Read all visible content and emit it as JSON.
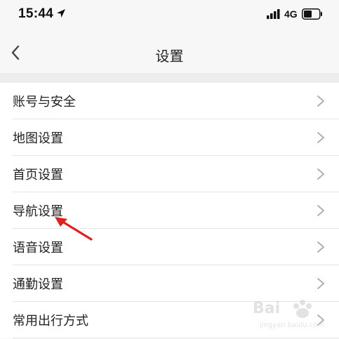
{
  "status_bar": {
    "time": "15:44",
    "network": "4G",
    "icons": [
      "location-arrow-icon",
      "signal-bars-icon",
      "battery-icon"
    ]
  },
  "nav": {
    "title": "设置",
    "back_icon": "chevron-left-icon"
  },
  "settings_items": [
    {
      "label": "账号与安全"
    },
    {
      "label": "地图设置"
    },
    {
      "label": "首页设置"
    },
    {
      "label": "导航设置"
    },
    {
      "label": "语音设置"
    },
    {
      "label": "通勤设置"
    },
    {
      "label": "常用出行方式"
    }
  ],
  "annotation": {
    "icon": "red-arrow-icon",
    "color": "#e02020"
  },
  "watermark": {
    "brand": "Bai",
    "url": "jingyan.baidu.com"
  },
  "colors": {
    "background": "#f7f7f7",
    "list_bg": "#ffffff",
    "divider": "#e6e6e6",
    "chevron": "#b0b0b0"
  }
}
